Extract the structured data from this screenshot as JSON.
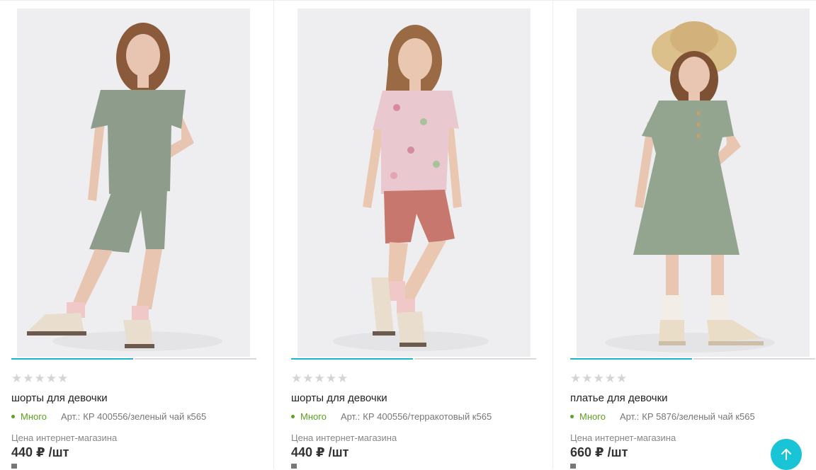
{
  "products": [
    {
      "rating_stars": "★★★★★",
      "title": "шорты для девочки",
      "stock": "Много",
      "article_label": "Арт.:",
      "article": "КР 400556/зеленый чай к565",
      "price_label": "Цена интернет-магазина",
      "price": "440 ₽",
      "unit": "/шт",
      "colors": {
        "top": "#8e9d8b",
        "bottom": "#8e9d8b",
        "skin": "#e7c5b0",
        "hair": "#8a5a3b"
      }
    },
    {
      "rating_stars": "★★★★★",
      "title": "шорты для девочки",
      "stock": "Много",
      "article_label": "Арт.:",
      "article": "КР 400556/терракотовый к565",
      "price_label": "Цена интернет-магазина",
      "price": "440 ₽",
      "unit": "/шт",
      "colors": {
        "top": "#e9c8cf",
        "bottom": "#c7776e",
        "skin": "#e9c7b1",
        "hair": "#9a6a45"
      }
    },
    {
      "rating_stars": "★★★★★",
      "title": "платье для девочки",
      "stock": "Много",
      "article_label": "Арт.:",
      "article": "КР 5876/зеленый чай к565",
      "price_label": "Цена интернет-магазина",
      "price": "660 ₽",
      "unit": "/шт",
      "colors": {
        "top": "#94a58f",
        "bottom": "#94a58f",
        "skin": "#e8c6b1",
        "hair": "#7e5034"
      }
    }
  ],
  "scroll_top_icon": "arrow-up-icon",
  "accent_color": "#19c4d6",
  "stock_color": "#5ba21e"
}
